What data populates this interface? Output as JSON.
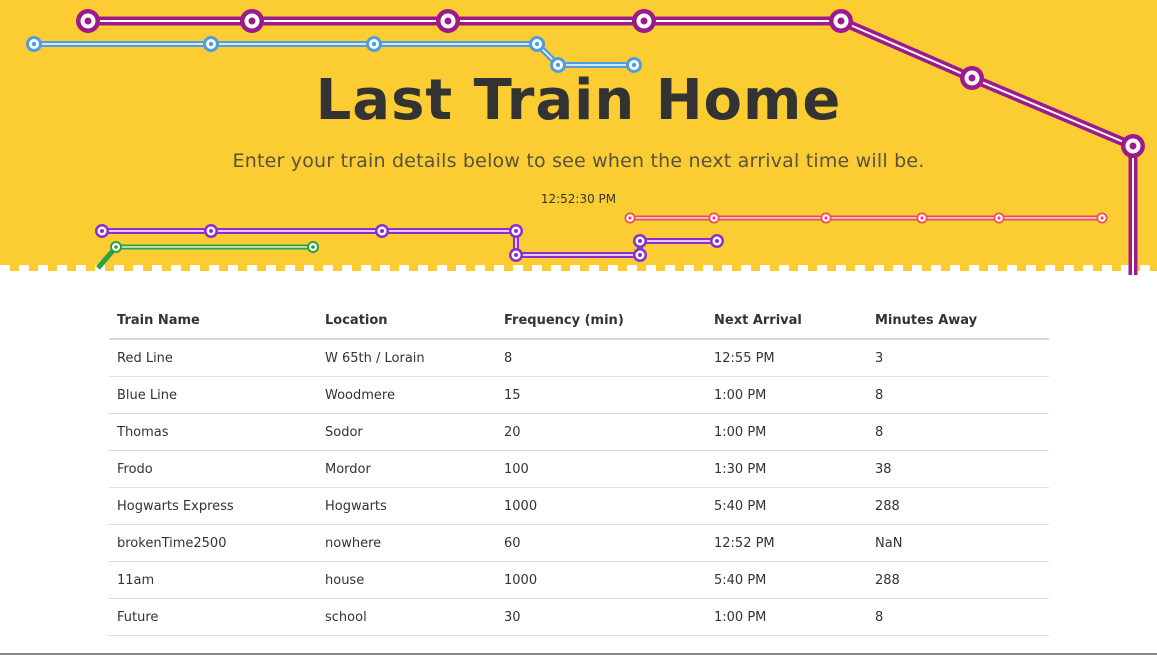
{
  "header": {
    "title": "Last Train Home",
    "subtitle": "Enter your train details below to see when the next arrival time will be.",
    "clock": "12:52:30 PM"
  },
  "colors": {
    "hero_background": "#fccd33",
    "magenta_line": "#9c1a8c",
    "blue_line": "#4f9de0",
    "purple_line": "#8b2fd1",
    "green_line": "#2aa043",
    "red_line": "#ef4a5a"
  },
  "table": {
    "headers": [
      "Train Name",
      "Location",
      "Frequency (min)",
      "Next Arrival",
      "Minutes Away"
    ],
    "rows": [
      [
        "Red Line",
        "W 65th / Lorain",
        "8",
        "12:55 PM",
        "3"
      ],
      [
        "Blue Line",
        "Woodmere",
        "15",
        "1:00 PM",
        "8"
      ],
      [
        "Thomas",
        "Sodor",
        "20",
        "1:00 PM",
        "8"
      ],
      [
        "Frodo",
        "Mordor",
        "100",
        "1:30 PM",
        "38"
      ],
      [
        "Hogwarts Express",
        "Hogwarts",
        "1000",
        "5:40 PM",
        "288"
      ],
      [
        "brokenTime2500",
        "nowhere",
        "60",
        "12:52 PM",
        "NaN"
      ],
      [
        "11am",
        "house",
        "1000",
        "5:40 PM",
        "288"
      ],
      [
        "Future",
        "school",
        "30",
        "1:00 PM",
        "8"
      ]
    ]
  }
}
